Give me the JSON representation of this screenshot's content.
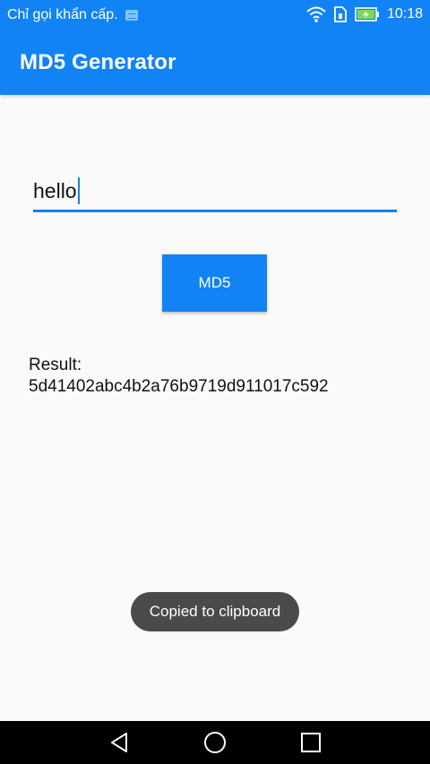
{
  "status_bar": {
    "carrier_text": "Chỉ gọi khẩn cấp.",
    "time": "10:18",
    "icons": [
      "notification-icon",
      "wifi-icon",
      "sim-icon",
      "battery-icon"
    ]
  },
  "app_bar": {
    "title": "MD5 Generator"
  },
  "input": {
    "value": "hello"
  },
  "button": {
    "label": "MD5"
  },
  "result": {
    "label": "Result:",
    "hash": "5d41402abc4b2a76b9719d911017c592"
  },
  "toast": {
    "message": "Copied to clipboard"
  },
  "nav_bar": {
    "icons": [
      "back-icon",
      "home-icon",
      "recents-icon"
    ]
  },
  "colors": {
    "primary": "#1283f5",
    "accent_underline": "#1a7fe8",
    "background": "#fafafa",
    "toast_bg": "#4a4a4a",
    "nav_bg": "#000000"
  }
}
